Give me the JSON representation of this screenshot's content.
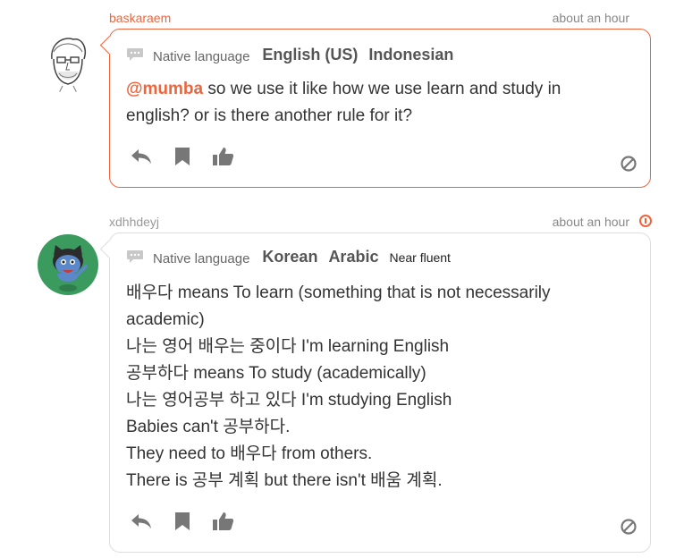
{
  "colors": {
    "accent": "#f0643c",
    "icon_gray": "#777777",
    "border": "#dddddd"
  },
  "posts": [
    {
      "author": "baskaraem",
      "time": "about an hour",
      "native_label": "Native language",
      "languages": [
        "English (US)",
        "Indonesian"
      ],
      "mention": "@mumba",
      "lines": [
        " so we use it like how we use learn and study in",
        "english? or is there another rule for it?"
      ],
      "icons": [
        "reply-icon",
        "bookmark-icon",
        "thumbs-up-icon",
        "block-icon"
      ]
    },
    {
      "author": "xdhhdeyj",
      "time": "about an hour",
      "native_label": "Native language",
      "languages": [
        "Korean",
        "Arabic"
      ],
      "level": "Near fluent",
      "lines": [
        "배우다 means To learn (something that is not necessarily",
        "academic)",
        "나는 영어 배우는 중이다 I'm learning English",
        "공부하다 means To study (academically)",
        "나는 영어공부 하고 있다 I'm studying English",
        "Babies can't 공부하다.",
        "They need to 배우다 from others.",
        "There is 공부 계획 but there isn't 배움 계획."
      ],
      "icons": [
        "reply-icon",
        "bookmark-icon",
        "thumbs-up-icon",
        "block-icon",
        "alert-icon"
      ]
    }
  ]
}
